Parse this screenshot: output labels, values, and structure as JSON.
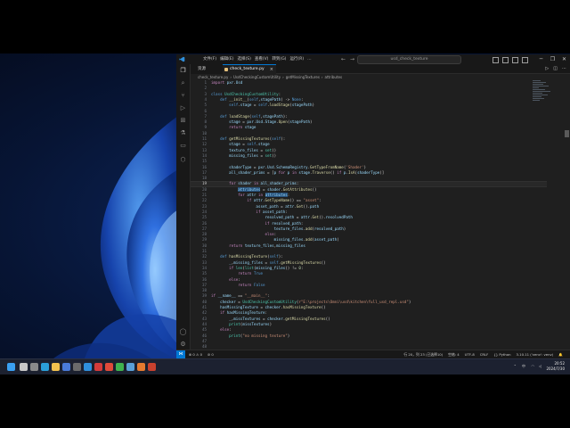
{
  "window": {
    "title": "usd_check_texture",
    "menu": [
      "文件(F)",
      "编辑(E)",
      "选择(S)",
      "查看(V)",
      "转到(G)",
      "运行(R)",
      "…"
    ],
    "controls": [
      "─",
      "❐",
      "✕"
    ]
  },
  "sidebar": {
    "title": "资源"
  },
  "tab": {
    "label": "check_texture.py",
    "close": "×"
  },
  "breadcrumb": [
    "check_texture.py",
    "›",
    "UsdCheckingCustomUtility",
    "›",
    "getMissingTextures",
    "›",
    "attributes"
  ],
  "code": {
    "current_line": 19,
    "lines": [
      {
        "n": 1,
        "t": "import pxr.Usd"
      },
      {
        "n": 2,
        "t": ""
      },
      {
        "n": 3,
        "t": "class UsdCheckingCustomUtility:"
      },
      {
        "n": 4,
        "t": "    def __init__(self,stagePath) -> None:"
      },
      {
        "n": 5,
        "t": "        self.stage = self.loadStage(stagePath)"
      },
      {
        "n": 6,
        "t": ""
      },
      {
        "n": 7,
        "t": "    def loadStage(self,stagePath):"
      },
      {
        "n": 8,
        "t": "        stage = pxr.Usd.Stage.Open(stagePath)"
      },
      {
        "n": 9,
        "t": "        return stage"
      },
      {
        "n": 10,
        "t": ""
      },
      {
        "n": 11,
        "t": "    def getMissingTextures(self):"
      },
      {
        "n": 12,
        "t": "        stage = self.stage"
      },
      {
        "n": 13,
        "t": "        texture_files = set()"
      },
      {
        "n": 14,
        "t": "        missing_files = set()"
      },
      {
        "n": 15,
        "t": ""
      },
      {
        "n": 16,
        "t": "        shaderType = pxr.Usd.SchemaRegistry.GetTypeFromName('Shader')"
      },
      {
        "n": 17,
        "t": "        all_shader_prims = [p for p in stage.Traverse() if p.IsA(shaderType)]"
      },
      {
        "n": 18,
        "t": ""
      },
      {
        "n": 19,
        "t": "        for shader in all_shader_prims:"
      },
      {
        "n": 20,
        "t": "            attributes = shader.GetAttributes()"
      },
      {
        "n": 21,
        "t": "            for attr in attributes:"
      },
      {
        "n": 22,
        "t": "                if attr.GetTypeName() == \"asset\":"
      },
      {
        "n": 23,
        "t": "                    asset_path = attr.Get().path"
      },
      {
        "n": 24,
        "t": "                    if asset_path:"
      },
      {
        "n": 25,
        "t": "                        resolved_path = attr.Get().resolvedPath"
      },
      {
        "n": 26,
        "t": "                        if resolved_path:"
      },
      {
        "n": 27,
        "t": "                            texture_files.add(resolved_path)"
      },
      {
        "n": 28,
        "t": "                        else:"
      },
      {
        "n": 29,
        "t": "                            missing_files.add(asset_path)"
      },
      {
        "n": 30,
        "t": "        return texture_files,missing_files"
      },
      {
        "n": 31,
        "t": ""
      },
      {
        "n": 32,
        "t": "    def hasMissingTexture(self):"
      },
      {
        "n": 33,
        "t": "        _,missing_files = self.getMissingTextures()"
      },
      {
        "n": 34,
        "t": "        if len(list(missing_files)) != 0:"
      },
      {
        "n": 35,
        "t": "            return True"
      },
      {
        "n": 36,
        "t": "        else:"
      },
      {
        "n": 37,
        "t": "            return False"
      },
      {
        "n": 38,
        "t": ""
      },
      {
        "n": 39,
        "t": "if __name__ == \"__main__\":"
      },
      {
        "n": 40,
        "t": "    checker = UsdCheckingCustomUtility(r\"E:\\projects\\Omni\\usd\\kitchen\\full_usd_repl.usd\")"
      },
      {
        "n": 41,
        "t": "    hasMissingTexture = checker.hasMissingTexture()"
      },
      {
        "n": 42,
        "t": "    if hasMissingTexture:"
      },
      {
        "n": 43,
        "t": "        _,missTextures = checker.getMissingTextures()"
      },
      {
        "n": 44,
        "t": "        print(missTextures)"
      },
      {
        "n": 45,
        "t": "    else:"
      },
      {
        "n": 46,
        "t": "        print(\"no missing texture\")"
      },
      {
        "n": 47,
        "t": ""
      },
      {
        "n": 48,
        "t": ""
      }
    ]
  },
  "statusbar": {
    "left": [
      "⊗ 0 ⚠ 0",
      "⊘ 0"
    ],
    "right": [
      "行 20，列 23 (已选择10)",
      "空格: 4",
      "UTF-8",
      "CRLF",
      "{} Python",
      "3.10.11 ('venv': venv)",
      "🔔"
    ]
  },
  "taskbar": {
    "time": "20:52",
    "date": "2024/7/30",
    "lang": "中",
    "icons": [
      {
        "name": "start-icon",
        "color": "#3aa0f2"
      },
      {
        "name": "search-icon",
        "color": "#c8c8c8"
      },
      {
        "name": "task-view-icon",
        "color": "#8a8a8a"
      },
      {
        "name": "edge-icon",
        "color": "#2b9fd8"
      },
      {
        "name": "file-explorer-icon",
        "color": "#f2c14e"
      },
      {
        "name": "store-icon",
        "color": "#4a7bd9"
      },
      {
        "name": "app-icon-1",
        "color": "#6b6b6b"
      },
      {
        "name": "vscode-icon",
        "color": "#2f8fdc"
      },
      {
        "name": "app-icon-2",
        "color": "#d43b3b"
      },
      {
        "name": "chrome-icon",
        "color": "#e04a3a"
      },
      {
        "name": "wechat-icon",
        "color": "#3fb34f"
      },
      {
        "name": "app-icon-3",
        "color": "#5aa0d8"
      },
      {
        "name": "app-icon-4",
        "color": "#e57a2f"
      },
      {
        "name": "app-icon-5",
        "color": "#c8412e"
      }
    ]
  }
}
